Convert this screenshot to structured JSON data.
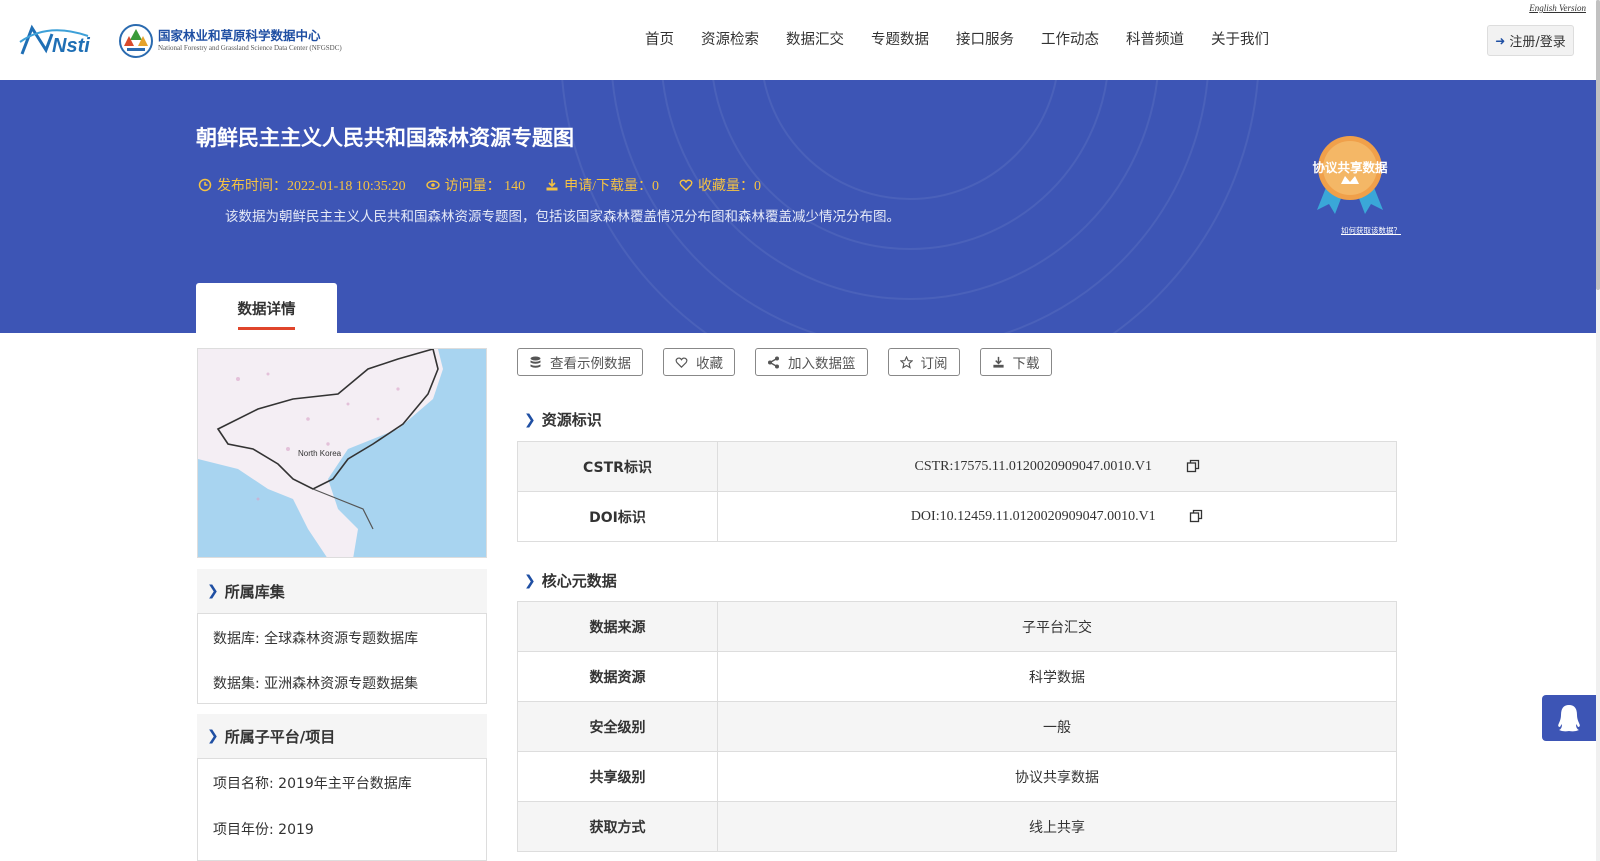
{
  "header": {
    "english_link": "English Version",
    "logo_nsti": "Nsti",
    "logo_title": "国家林业和草原科学数据中心",
    "logo_subtitle": "National Forestry and Grassland Science Data Center (NFGSDC)",
    "nav": [
      "首页",
      "资源检索",
      "数据汇交",
      "专题数据",
      "接口服务",
      "工作动态",
      "科普频道",
      "关于我们"
    ],
    "login_label": "注册/登录"
  },
  "banner": {
    "title": "朝鲜民主主义人民共和国森林资源专题图",
    "publish_time": "发布时间：2022-01-18 10:35:20",
    "views": "访问量： 140",
    "downloads": "申请/下载量：0",
    "favorites": "收藏量：0",
    "description": "该数据为朝鲜民主主义人民共和国森林资源专题图，包括该国家森林覆盖情况分布图和森林覆盖减少情况分布图。",
    "badge_text": "协议共享数据",
    "badge_link": "如何获取该数据？",
    "tab_label": "数据详情"
  },
  "colors": {
    "brand_blue": "#3d55b5",
    "accent_gold": "#f5c242",
    "tab_underline": "#e0452b"
  },
  "sidebar": {
    "thumbnail_label": "North Korea",
    "library_title": "所属库集",
    "database": "数据库: 全球森林资源专题数据库",
    "dataset": "数据集: 亚洲森林资源专题数据集",
    "project_title": "所属子平台/项目",
    "project_name": "项目名称: 2019年主平台数据库",
    "project_year": "项目年份: 2019"
  },
  "actions": {
    "sample": "查看示例数据",
    "favorite": "收藏",
    "basket": "加入数据篮",
    "subscribe": "订阅",
    "download": "下载"
  },
  "resource_id": {
    "title": "资源标识",
    "rows": [
      {
        "key": "CSTR标识",
        "value": "CSTR:17575.11.0120020909047.0010.V1"
      },
      {
        "key": "DOI标识",
        "value": "DOI:10.12459.11.0120020909047.0010.V1"
      }
    ]
  },
  "core_meta": {
    "title": "核心元数据",
    "rows": [
      {
        "key": "数据来源",
        "value": "子平台汇交"
      },
      {
        "key": "数据资源",
        "value": "科学数据"
      },
      {
        "key": "安全级别",
        "value": "一般"
      },
      {
        "key": "共享级别",
        "value": "协议共享数据"
      },
      {
        "key": "获取方式",
        "value": "线上共享"
      }
    ]
  }
}
